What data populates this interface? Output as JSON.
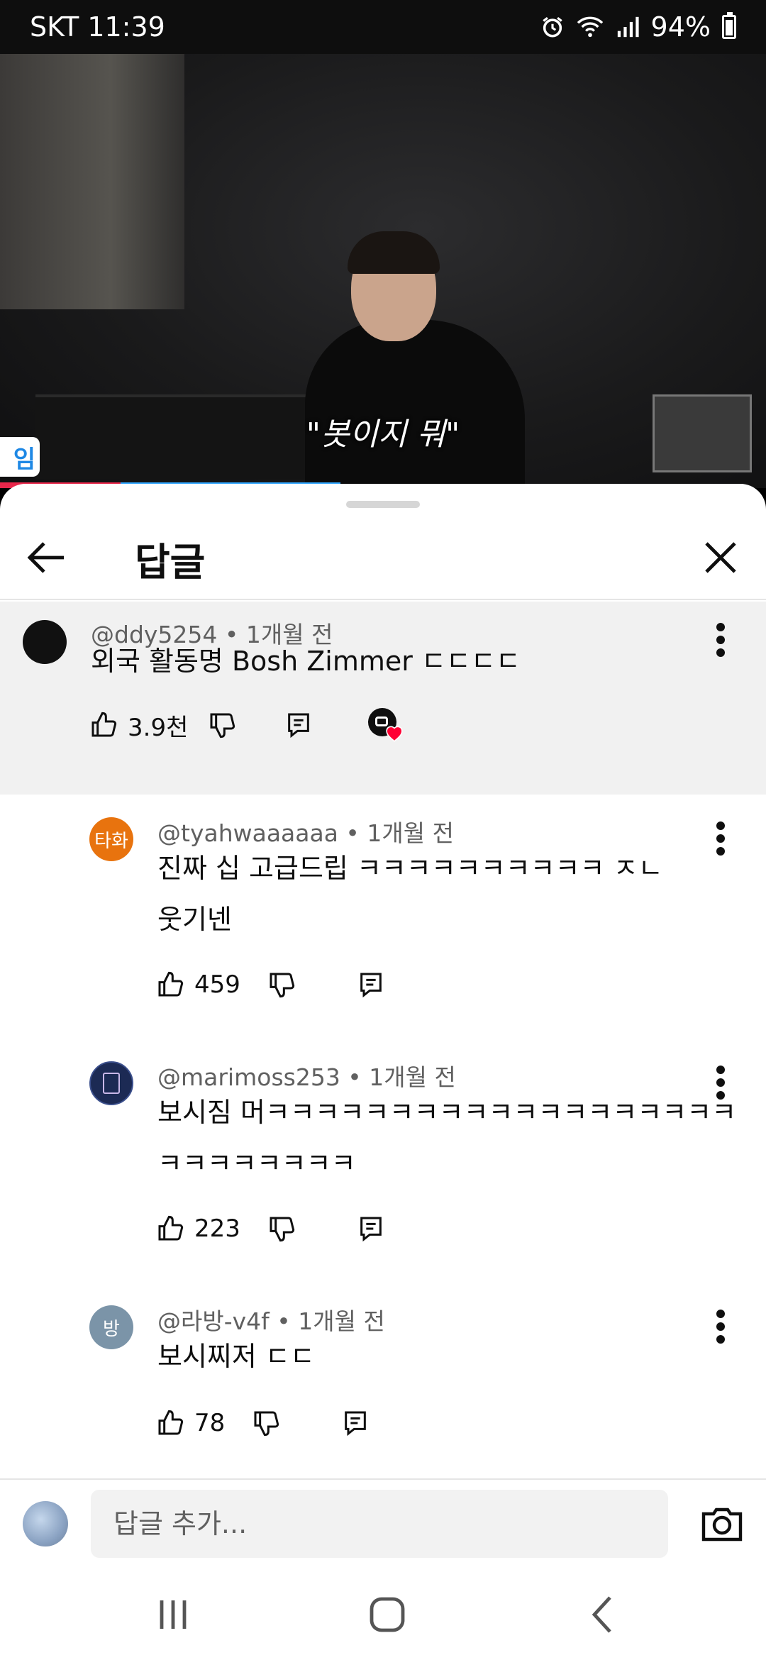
{
  "status": {
    "carrier": "SKT",
    "time": "11:39",
    "battery": "94%"
  },
  "video": {
    "subtitle": "\"봇이지 뭐\"",
    "tag": "임",
    "progress": 0.44
  },
  "sheet": {
    "title": "답글"
  },
  "parent_comment": {
    "author": "@ddy5254",
    "time": "1개월 전",
    "text": "외국 활동명 Bosh Zimmer ㄷㄷㄷㄷ",
    "likes": "3.9천",
    "avatar_color": "#111111"
  },
  "replies": [
    {
      "author": "@tyahwaaaaaa",
      "time": "1개월 전",
      "lines": [
        "진짜 십 고급드립 ㅋㅋㅋㅋㅋㅋㅋㅋㅋㅋ ㅈㄴ",
        "웃기넨"
      ],
      "likes": "459",
      "avatar_text": "타화",
      "avatar_color": "#e8730e"
    },
    {
      "author": "@marimoss253",
      "time": "1개월 전",
      "lines": [
        "보시짐 머ㅋㅋㅋㅋㅋㅋㅋㅋㅋㅋㅋㅋㅋㅋㅋㅋㅋㅋㅋ",
        "ㅋㅋㅋㅋㅋㅋㅋㅋ"
      ],
      "likes": "223",
      "avatar_text": "",
      "avatar_color": "#1c2a54"
    },
    {
      "author": "@라방-v4f",
      "time": "1개월 전",
      "lines": [
        "보시찌저 ㄷㄷ"
      ],
      "likes": "78",
      "avatar_text": "방",
      "avatar_color": "#7b94a8"
    }
  ],
  "reply_input": {
    "placeholder": "답글 추가..."
  },
  "colors": {
    "text": "#0f0f0f",
    "meta": "#606060",
    "highlight_bg": "#f1f1f1",
    "heart": "#ff0033"
  }
}
